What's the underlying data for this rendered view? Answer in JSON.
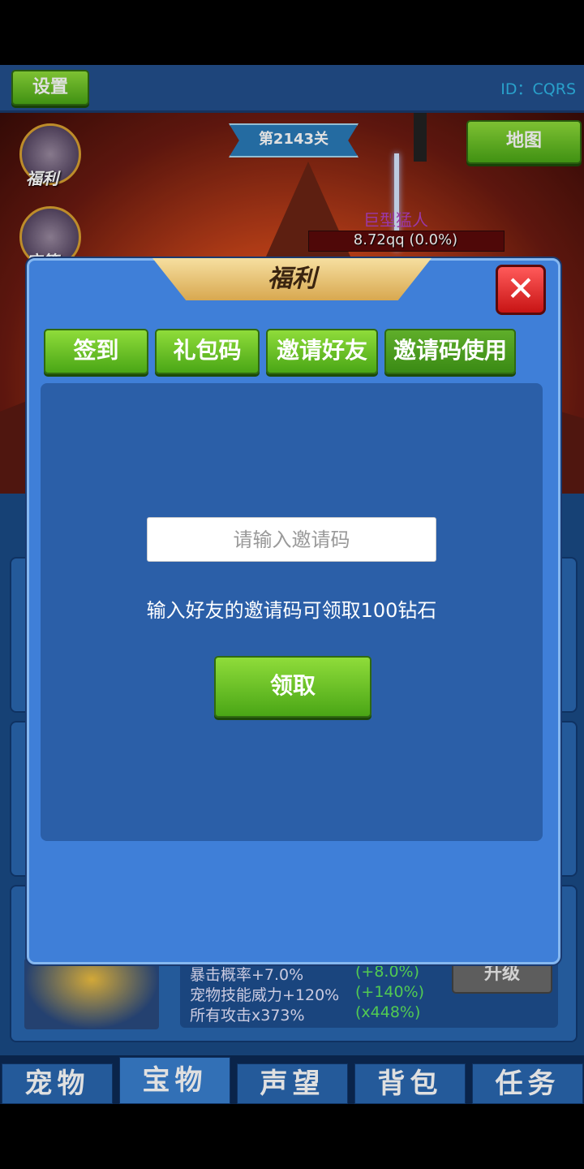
{
  "header": {
    "settings_label": "设置",
    "player_id": "ID：CQRS",
    "level": "第2143关",
    "map_label": "地图"
  },
  "side_icons": {
    "benefit_label": "福利",
    "chest_label": "宝箱"
  },
  "boss": {
    "name": "巨型猛人",
    "hp_text": "8.72qq (0.0%)",
    "hp_fraction": 0.0
  },
  "upgrade": {
    "stats": [
      {
        "label": "暴击概率+7.0%",
        "bonus": "(+8.0%)"
      },
      {
        "label": "宠物技能威力+120%",
        "bonus": "(+140%)"
      },
      {
        "label": "所有攻击x373%",
        "bonus": "(x448%)"
      }
    ],
    "button_label": "升级"
  },
  "bottom_nav": [
    {
      "label": "宠物",
      "active": false
    },
    {
      "label": "宝物",
      "active": true
    },
    {
      "label": "声望",
      "active": false
    },
    {
      "label": "背包",
      "active": false
    },
    {
      "label": "任务",
      "active": false
    }
  ],
  "modal": {
    "title": "福利",
    "close_glyph": "✕",
    "tabs": [
      {
        "label": "签到"
      },
      {
        "label": "礼包码"
      },
      {
        "label": "邀请好友"
      },
      {
        "label": "邀请码使用",
        "active": true
      }
    ],
    "input_value": "",
    "input_placeholder": "请输入邀请码",
    "hint": "输入好友的邀请码可领取100钻石",
    "claim_label": "领取"
  }
}
